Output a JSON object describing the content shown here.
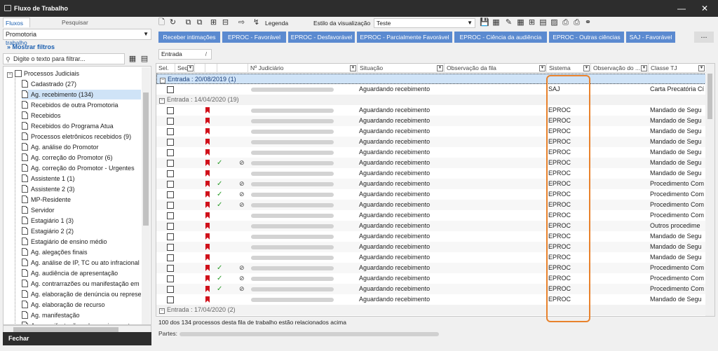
{
  "window": {
    "title": "Fluxo de Trabalho"
  },
  "left": {
    "tabs": [
      "Fluxos de trabalho",
      "Pesquisar"
    ],
    "combo_value": "Promotoria",
    "show_filters": "Mostrar filtros",
    "filter_placeholder": "Digite o texto para filtrar...",
    "root": "Processos Judiciais",
    "items": [
      "Cadastrado (27)",
      "Ag. recebimento (134)",
      "Recebidos de outra Promotoria",
      "Recebidos",
      "Recebidos do Programa Atua",
      "Processos eletrônicos recebidos (9)",
      "Ag. análise do Promotor",
      "Ag. correção do Promotor (6)",
      "Ag. correção do Promotor - Urgentes",
      "Assistente 1 (1)",
      "Assistente 2 (3)",
      "MP-Residente",
      "Servidor",
      "Estagiário 1 (3)",
      "Estagiário 2 (2)",
      "Estagiário de ensino médio",
      "Ag. alegações finais",
      "Ag. análise de IP, TC ou ato infracional",
      "Ag. audiência de apresentação",
      "Ag. contrarrazões ou manifestação em",
      "Ag. elaboração de denúncia ou represe",
      "Ag. elaboração de recurso",
      "Ag. manifestação",
      "Ag. manifestação pelo arquivamento"
    ],
    "selected_index": 1,
    "close_label": "Fechar"
  },
  "toolbar": {
    "legend_label": "Legenda",
    "style_label": "Estilo da visualização",
    "style_value": "Teste",
    "actions": [
      "Receber intimações",
      "EPROC - Favorável",
      "EPROC - Desfavorável",
      "EPROC - Parcialmente Favorável",
      "EPROC - Ciência da audiência",
      "EPROC - Outras ciências",
      "SAJ - Favorável"
    ],
    "more_label": "..."
  },
  "group_by": "Entrada",
  "grid": {
    "columns": [
      "Sel.",
      "Seq.",
      "",
      "",
      "",
      "Nº Judiciário",
      "Situação",
      "Observação da fila",
      "Sistema",
      "Observação do ...",
      "Classe TJ"
    ],
    "groups": [
      {
        "label": "Entrada : 20/08/2019  (1)",
        "rows": [
          {
            "situacao": "Aguardando recebimento",
            "sistema": "SAJ",
            "classe": "Carta Precatória Cí",
            "flag": false,
            "tick": false,
            "clip": false
          }
        ]
      },
      {
        "label": "Entrada : 14/04/2020  (19)",
        "rows": [
          {
            "situacao": "Aguardando recebimento",
            "sistema": "EPROC",
            "classe": "Mandado de Segu",
            "flag": true,
            "tick": false,
            "clip": false
          },
          {
            "situacao": "Aguardando recebimento",
            "sistema": "EPROC",
            "classe": "Mandado de Segu",
            "flag": true,
            "tick": false,
            "clip": false
          },
          {
            "situacao": "Aguardando recebimento",
            "sistema": "EPROC",
            "classe": "Mandado de Segu",
            "flag": true,
            "tick": false,
            "clip": false
          },
          {
            "situacao": "Aguardando recebimento",
            "sistema": "EPROC",
            "classe": "Mandado de Segu",
            "flag": true,
            "tick": false,
            "clip": false
          },
          {
            "situacao": "Aguardando recebimento",
            "sistema": "EPROC",
            "classe": "Mandado de Segu",
            "flag": true,
            "tick": false,
            "clip": false
          },
          {
            "situacao": "Aguardando recebimento",
            "sistema": "EPROC",
            "classe": "Mandado de Segu",
            "flag": true,
            "tick": true,
            "clip": true
          },
          {
            "situacao": "Aguardando recebimento",
            "sistema": "EPROC",
            "classe": "Mandado de Segu",
            "flag": true,
            "tick": false,
            "clip": false
          },
          {
            "situacao": "Aguardando recebimento",
            "sistema": "EPROC",
            "classe": "Procedimento Com",
            "flag": true,
            "tick": true,
            "clip": true
          },
          {
            "situacao": "Aguardando recebimento",
            "sistema": "EPROC",
            "classe": "Procedimento Com",
            "flag": true,
            "tick": true,
            "clip": true
          },
          {
            "situacao": "Aguardando recebimento",
            "sistema": "EPROC",
            "classe": "Procedimento Com",
            "flag": true,
            "tick": true,
            "clip": true
          },
          {
            "situacao": "Aguardando recebimento",
            "sistema": "EPROC",
            "classe": "Procedimento Com",
            "flag": true,
            "tick": false,
            "clip": false
          },
          {
            "situacao": "Aguardando recebimento",
            "sistema": "EPROC",
            "classe": "Outros procedime",
            "flag": true,
            "tick": false,
            "clip": false
          },
          {
            "situacao": "Aguardando recebimento",
            "sistema": "EPROC",
            "classe": "Mandado de Segu",
            "flag": true,
            "tick": false,
            "clip": false
          },
          {
            "situacao": "Aguardando recebimento",
            "sistema": "EPROC",
            "classe": "Mandado de Segu",
            "flag": true,
            "tick": false,
            "clip": false
          },
          {
            "situacao": "Aguardando recebimento",
            "sistema": "EPROC",
            "classe": "Mandado de Segu",
            "flag": true,
            "tick": false,
            "clip": false
          },
          {
            "situacao": "Aguardando recebimento",
            "sistema": "EPROC",
            "classe": "Procedimento Com",
            "flag": true,
            "tick": true,
            "clip": true
          },
          {
            "situacao": "Aguardando recebimento",
            "sistema": "EPROC",
            "classe": "Procedimento Com",
            "flag": true,
            "tick": true,
            "clip": true
          },
          {
            "situacao": "Aguardando recebimento",
            "sistema": "EPROC",
            "classe": "Procedimento Com",
            "flag": true,
            "tick": true,
            "clip": true
          },
          {
            "situacao": "Aguardando recebimento",
            "sistema": "EPROC",
            "classe": "Mandado de Segu",
            "flag": true,
            "tick": false,
            "clip": false
          }
        ]
      },
      {
        "label": "Entrada : 17/04/2020  (2)",
        "rows": []
      }
    ]
  },
  "status": "100 dos 134 processos desta fila de trabalho estão relacionados acima",
  "partes_label": "Partes:",
  "colors": {
    "accent": "#5b8ad0",
    "highlight": "#e8822c",
    "flag": "#d0101a",
    "titlebar": "#2d2d2d"
  }
}
